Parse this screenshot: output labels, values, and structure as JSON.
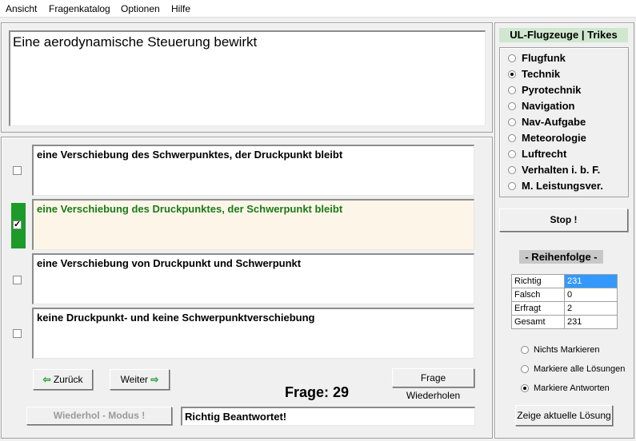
{
  "menu": [
    "Ansicht",
    "Fragenkatalog",
    "Optionen",
    "Hilfe"
  ],
  "question": "Eine aerodynamische Steuerung bewirkt",
  "answers": [
    {
      "text": "eine Verschiebung des Schwerpunktes, der Druckpunkt bleibt",
      "checked": false
    },
    {
      "text": "eine Verschiebung des Druckpunktes, der Schwerpunkt bleibt",
      "checked": true
    },
    {
      "text": "eine Verschiebung von Druckpunkt und Schwerpunkt",
      "checked": false
    },
    {
      "text": "keine Druckpunkt- und keine Schwerpunktverschiebung",
      "checked": false
    }
  ],
  "nav": {
    "back": "Zurück",
    "next": "Weiter",
    "repeat": "Frage Wiederholen",
    "wiederhol_mode": "Wiederhol - Modus !"
  },
  "frage_label": "Frage: 29",
  "status_text": "Richtig Beantwortet!",
  "category": {
    "title": "UL-Flugzeuge | Trikes",
    "items": [
      "Flugfunk",
      "Technik",
      "Pyrotechnik",
      "Navigation",
      "Nav-Aufgabe",
      "Meteorologie",
      "Luftrecht",
      "Verhalten i. b. F.",
      "M. Leistungsver."
    ],
    "selected": "Technik"
  },
  "stop_label": "Stop !",
  "reihenfolge": "- Reihenfolge -",
  "stats": [
    {
      "label": "Richtig",
      "value": "231"
    },
    {
      "label": "Falsch",
      "value": "0"
    },
    {
      "label": "Erfragt",
      "value": "2"
    },
    {
      "label": "Gesamt",
      "value": "231"
    }
  ],
  "mark_options": [
    "Nichts Markieren",
    "Markiere alle Lösungen",
    "Markiere Antworten"
  ],
  "mark_selected": "Markiere Antworten",
  "show_solution": "Zeige aktuelle Lösung",
  "colors": {
    "correct_green": "#1c9a2a",
    "selection_blue": "#3399ff",
    "header_green": "#cfe7cf"
  }
}
